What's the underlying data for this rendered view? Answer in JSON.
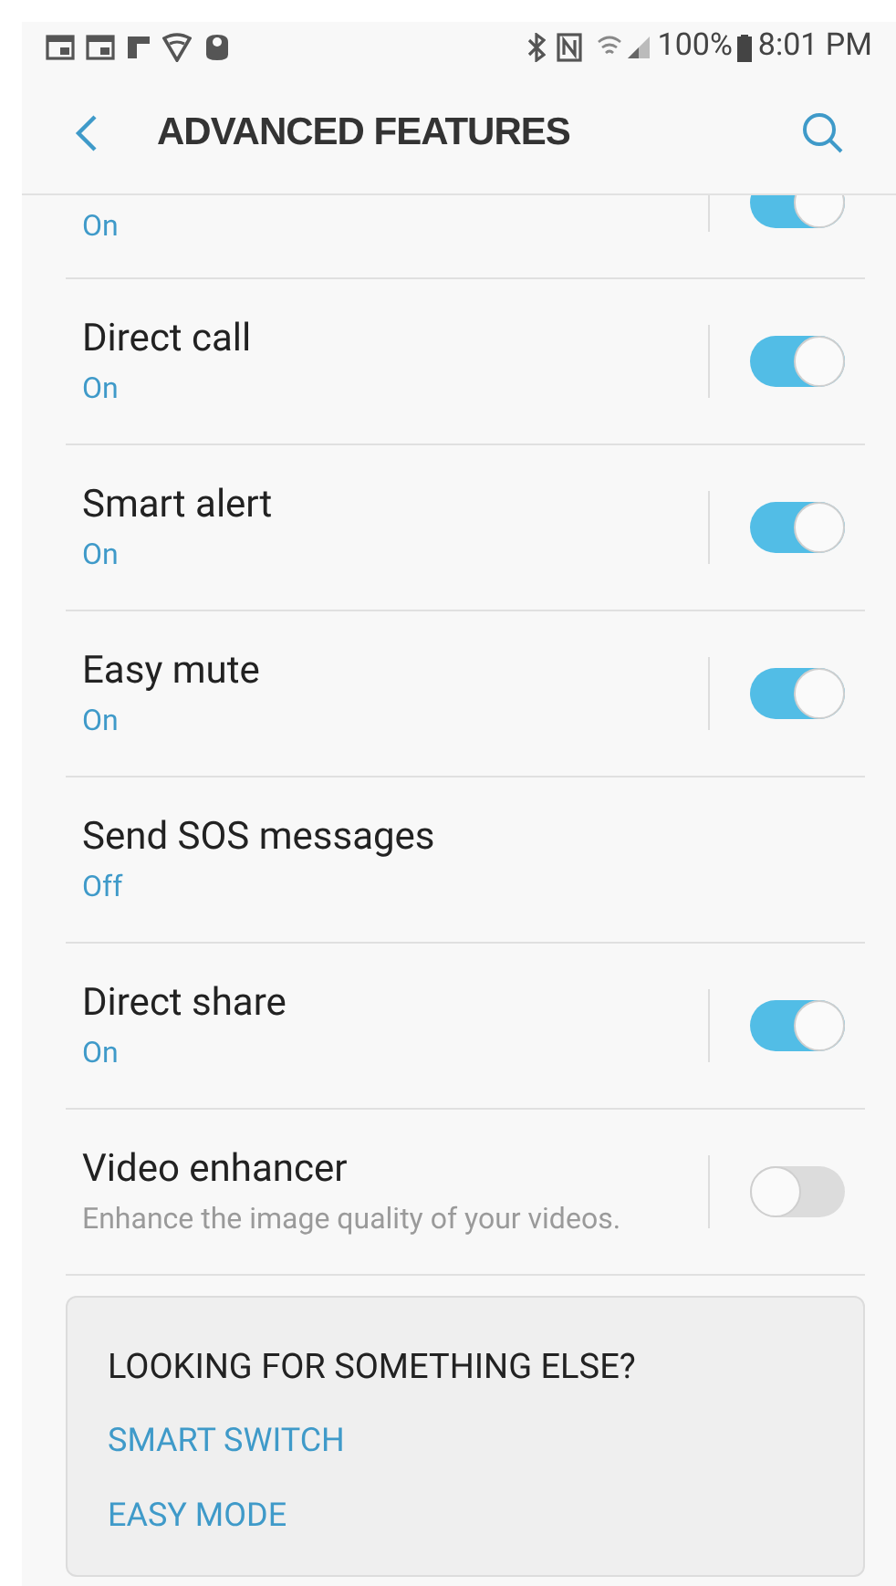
{
  "status_bar": {
    "battery": "100%",
    "time": "8:01 PM"
  },
  "header": {
    "title": "ADVANCED FEATURES"
  },
  "settings": [
    {
      "status": "On",
      "on": true
    },
    {
      "title": "Direct call",
      "status": "On",
      "on": true
    },
    {
      "title": "Smart alert",
      "status": "On",
      "on": true
    },
    {
      "title": "Easy mute",
      "status": "On",
      "on": true
    },
    {
      "title": "Send SOS messages",
      "status": "Off"
    },
    {
      "title": "Direct share",
      "status": "On",
      "on": true
    },
    {
      "title": "Video enhancer",
      "description": "Enhance the image quality of your videos.",
      "on": false
    }
  ],
  "suggestions": {
    "heading": "LOOKING FOR SOMETHING ELSE?",
    "links": [
      "SMART SWITCH",
      "EASY MODE"
    ]
  }
}
